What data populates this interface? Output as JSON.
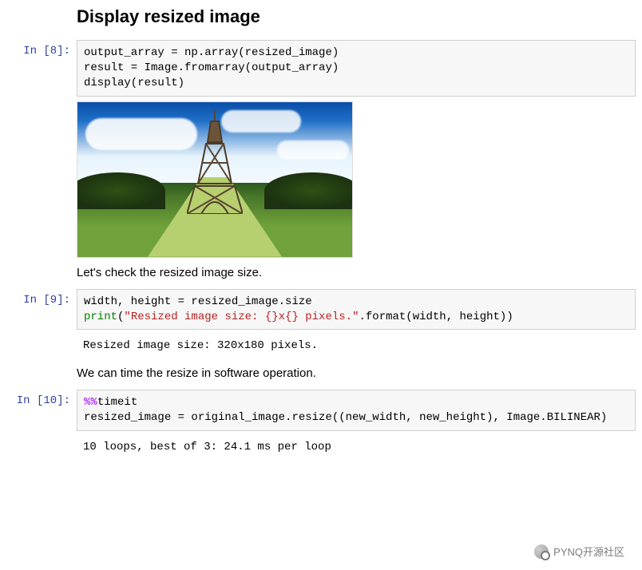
{
  "heading": "Display resized image",
  "cells": [
    {
      "prompt": "In  [8]:",
      "code_html": "output_array = np.array(resized_image)\nresult = Image.fromarray(output_array)\ndisplay(result)",
      "output_image_alt": "Eiffel Tower resized image output"
    },
    {
      "markdown": "Let's check the resized image size."
    },
    {
      "prompt": "In  [9]:",
      "code_html": "width, height = resized_image.size\n<span class=\"tok-builtin\">print</span>(<span class=\"tok-str\">\"Resized image size: {}x{} pixels.\"</span>.format(width, height))",
      "output_text": "Resized image size: 320x180 pixels."
    },
    {
      "markdown": "We can time the resize in software operation."
    },
    {
      "prompt": "In [10]:",
      "code_html": "<span class=\"tok-magic\">%%</span>timeit\nresized_image = original_image.resize((new_width, new_height), Image.BILINEAR)",
      "output_text": "10 loops, best of 3: 24.1 ms per loop"
    }
  ],
  "watermark": "PYNQ开源社区"
}
